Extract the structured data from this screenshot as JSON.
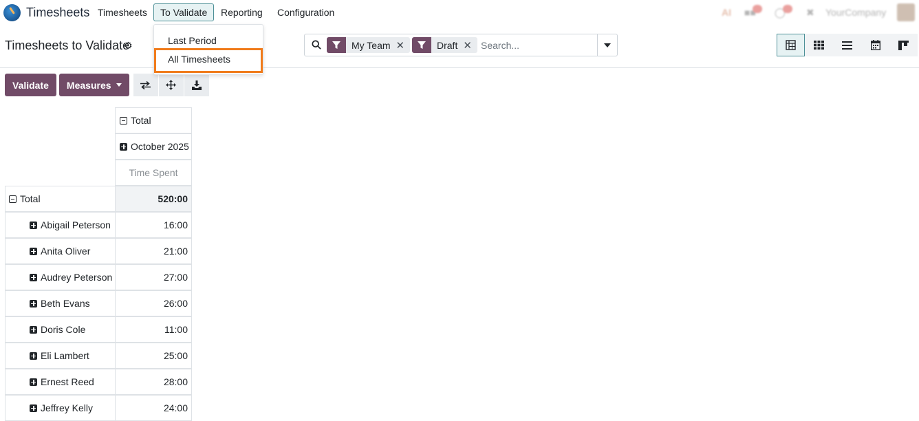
{
  "app": {
    "name": "Timesheets"
  },
  "menu": {
    "items": [
      {
        "label": "Timesheets",
        "active": false
      },
      {
        "label": "To Validate",
        "active": true
      },
      {
        "label": "Reporting",
        "active": false
      },
      {
        "label": "Configuration",
        "active": false
      }
    ]
  },
  "systray": {
    "company": "YourCompany",
    "ai_label": "AI"
  },
  "dropdown": {
    "items": [
      {
        "label": "Last Period",
        "highlighted": false
      },
      {
        "label": "All Timesheets",
        "highlighted": true
      }
    ],
    "highlight_color": "#f07b1b"
  },
  "control_panel": {
    "title": "Timesheets to Validate"
  },
  "search": {
    "facets": [
      {
        "label": "My Team"
      },
      {
        "label": "Draft"
      }
    ],
    "placeholder": "Search..."
  },
  "views": [
    {
      "name": "pivot-view",
      "active": true
    },
    {
      "name": "grid-view",
      "active": false
    },
    {
      "name": "list-view",
      "active": false
    },
    {
      "name": "calendar-view",
      "active": false
    },
    {
      "name": "kanban-view",
      "active": false
    }
  ],
  "buttons": {
    "validate": "Validate",
    "measures": "Measures"
  },
  "pivot": {
    "col_header_total": "Total",
    "col_header_period": "October 2025",
    "measure": "Time Spent",
    "row_header_total": "Total",
    "total_value": "520:00",
    "rows": [
      {
        "name": "Abigail Peterson",
        "value": "16:00"
      },
      {
        "name": "Anita Oliver",
        "value": "21:00"
      },
      {
        "name": "Audrey Peterson",
        "value": "27:00"
      },
      {
        "name": "Beth Evans",
        "value": "26:00"
      },
      {
        "name": "Doris Cole",
        "value": "11:00"
      },
      {
        "name": "Eli Lambert",
        "value": "25:00"
      },
      {
        "name": "Ernest Reed",
        "value": "28:00"
      },
      {
        "name": "Jeffrey Kelly",
        "value": "24:00"
      }
    ]
  },
  "colors": {
    "brand": "#714b67",
    "accent": "#4c8f96"
  }
}
